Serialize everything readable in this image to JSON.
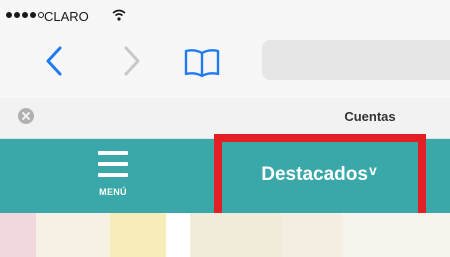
{
  "status_bar": {
    "carrier": "CLARO",
    "signal_dots": [
      true,
      true,
      true,
      true,
      false
    ],
    "wifi_icon": "wifi-icon"
  },
  "browser": {
    "back_icon": "back-icon",
    "forward_icon": "forward-icon",
    "bookmarks_icon": "bookmarks-icon",
    "tab_title": "Cuentas"
  },
  "site_header": {
    "background": "#3aa8a8",
    "menu_label": "MENÚ",
    "section_label": "Destacados",
    "section_chevron": "v"
  },
  "annotation": {
    "highlight_color": "#e31e24"
  }
}
